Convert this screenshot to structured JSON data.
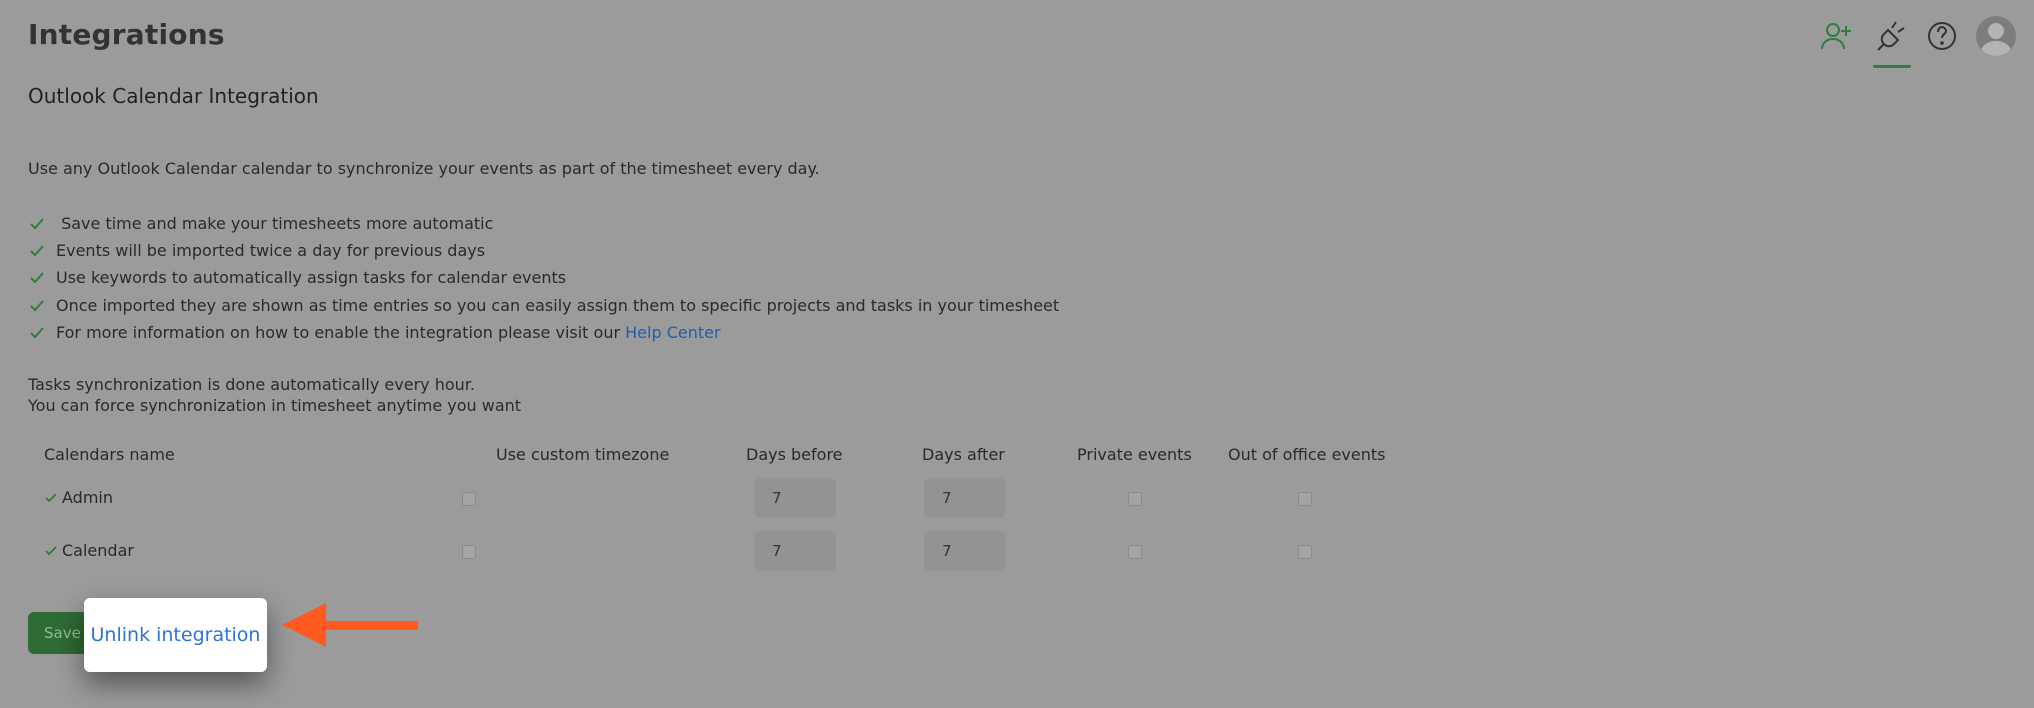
{
  "header": {
    "title": "Integrations",
    "icons": [
      "add-user-icon",
      "plug-icon",
      "help-icon",
      "avatar"
    ]
  },
  "section": {
    "title": "Outlook Calendar Integration",
    "intro": "Use any Outlook Calendar calendar to synchronize your events as part of the timesheet every day.",
    "features": [
      " Save time and make your timesheets more automatic",
      "Events will be imported twice a day for previous days",
      "Use keywords to automatically assign tasks for calendar events",
      "Once imported they are shown as time entries so you can easily assign them to specific projects and tasks in your timesheet",
      "For more information on how to enable the integration please visit our "
    ],
    "help_link": "Help Center",
    "sync_line1": "Tasks synchronization is done automatically every hour.",
    "sync_line2": "You can force synchronization in timesheet anytime you want"
  },
  "table": {
    "headers": {
      "name": "Calendars name",
      "timezone": "Use custom timezone",
      "before": "Days before",
      "after": "Days after",
      "private": "Private events",
      "ooo": "Out of office events"
    },
    "rows": [
      {
        "name": "Admin",
        "days_before": "7",
        "days_after": "7"
      },
      {
        "name": "Calendar",
        "days_before": "7",
        "days_after": "7"
      }
    ]
  },
  "actions": {
    "save_label": "Save",
    "unlink_label": "Unlink integration"
  },
  "colors": {
    "accent_green": "#2f7d3a",
    "link_blue": "#2d74d9",
    "arrow_orange": "#ff5a1f"
  }
}
